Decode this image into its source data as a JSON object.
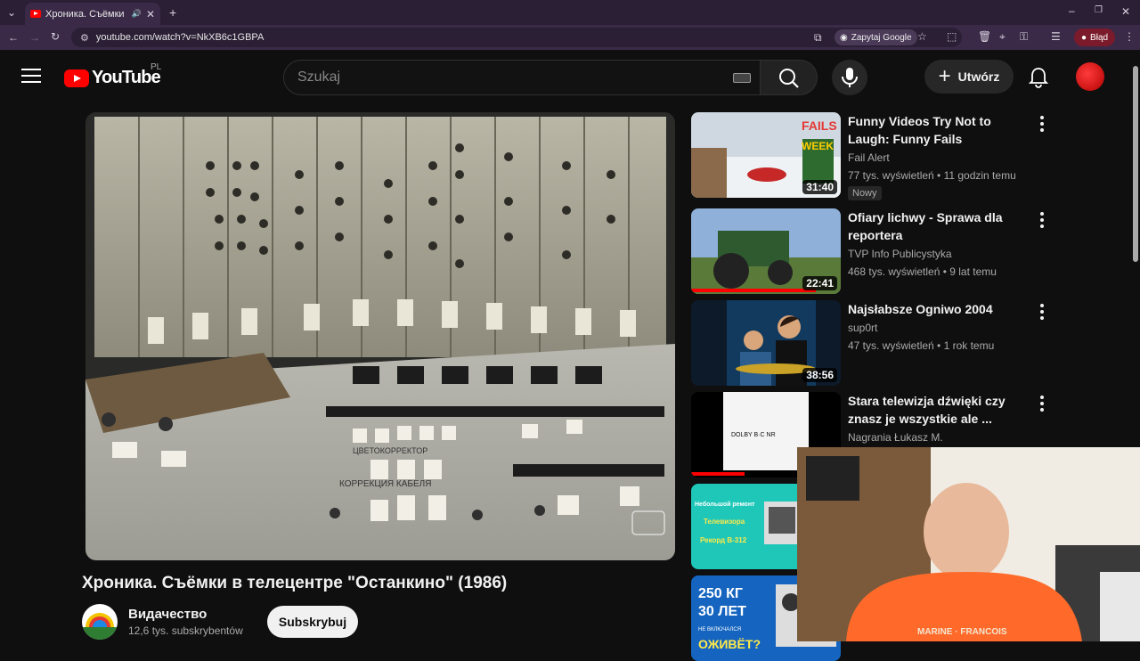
{
  "browser": {
    "tab_title": "Хроника. Съёмки в телец",
    "url": "youtube.com/watch?v=NkXB6c1GBPA",
    "ask_google": "Zapytaj Google",
    "profile_status": "Błąd"
  },
  "header": {
    "logo_text": "YouTube",
    "country_code": "PL",
    "search_placeholder": "Szukaj",
    "create_label": "Utwórz"
  },
  "video": {
    "title": "Хроника. Съёмки в телецентре \"Останкино\" (1986)",
    "channel": "Видачество",
    "subscribers": "12,6 tys. subskrybentów",
    "subscribe_label": "Subskrybuj",
    "panel_labels": [
      "ЦВЕТОКОРРЕКТОР",
      "КОРРЕКЦИЯ КАБЕЛЯ"
    ]
  },
  "recommendations": [
    {
      "title": "Funny Videos Try Not to Laugh: Funny Fails Compilation: Peop...",
      "channel": "Fail Alert",
      "meta": "77 tys. wyświetleń • 11 godzin temu",
      "duration": "31:40",
      "badge": "Nowy",
      "thumb_text": "FAILS OF THE WEEK"
    },
    {
      "title": "Ofiary lichwy - Sprawa dla reportera",
      "channel": "TVP Info Publicystyka",
      "meta": "468 tys. wyświetleń • 9 lat temu",
      "duration": "22:41"
    },
    {
      "title": "Najsłabsze Ogniwo 2004",
      "channel": "sup0rt",
      "meta": "47 tys. wyświetleń • 1 rok temu",
      "duration": "38:56"
    },
    {
      "title": "Stara telewizja dźwięki czy znasz je wszystkie ale ...",
      "channel": "Nagrania Łukasz M.",
      "thumb_text": "DOLBY B·C NR"
    },
    {
      "thumb_text": "Небольшой ремонт Телевизора Рекорд В-312"
    },
    {
      "thumb_text": "250 КГ 30 ЛЕТ НЕ ВКЛЮЧАЛСЯ ОЖИВЁТ?"
    }
  ],
  "colors": {
    "background": "#0f0f0f",
    "brand_red": "#ff0000",
    "text_primary": "#f1f1f1",
    "text_secondary": "#aaaaaa",
    "browser_frame": "#2b1f35"
  }
}
